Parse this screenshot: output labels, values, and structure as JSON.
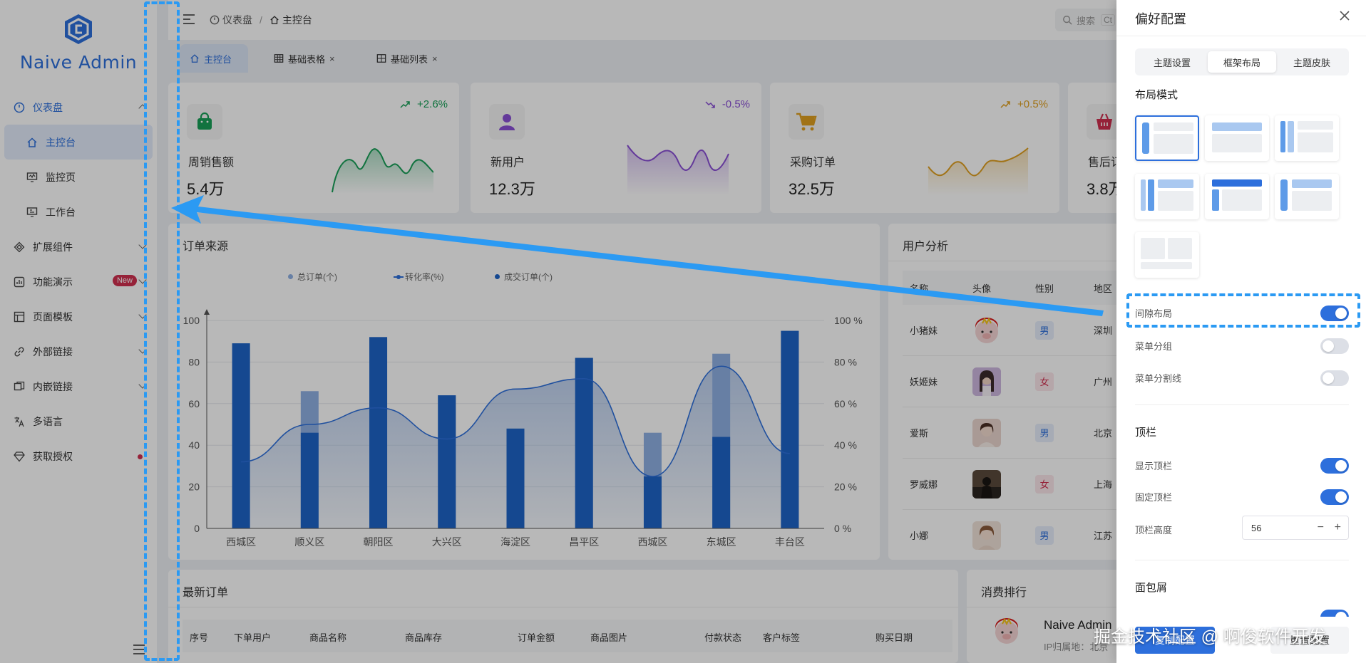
{
  "app": {
    "name": "Naive Admin"
  },
  "sidebar": {
    "items": [
      {
        "label": "仪表盘",
        "icon": "dashboard-icon"
      },
      {
        "label": "主控台",
        "icon": "home-icon"
      },
      {
        "label": "监控页",
        "icon": "monitor-icon"
      },
      {
        "label": "工作台",
        "icon": "workbench-icon"
      },
      {
        "label": "扩展组件",
        "icon": "puzzle-icon"
      },
      {
        "label": "功能演示",
        "icon": "feature-icon",
        "badge": "New"
      },
      {
        "label": "页面模板",
        "icon": "template-icon"
      },
      {
        "label": "外部链接",
        "icon": "link-icon"
      },
      {
        "label": "内嵌链接",
        "icon": "embed-icon"
      },
      {
        "label": "多语言",
        "icon": "translate-icon"
      },
      {
        "label": "获取授权",
        "icon": "diamond-icon"
      }
    ]
  },
  "header": {
    "breadcrumb": [
      "仪表盘",
      "主控台"
    ],
    "separator": "/",
    "search_placeholder": "搜索",
    "search_shortcut": "Ct"
  },
  "tabs": [
    {
      "label": "主控台",
      "icon": "home-icon",
      "closable": false
    },
    {
      "label": "基础表格",
      "icon": "table-icon",
      "closable": true
    },
    {
      "label": "基础列表",
      "icon": "table-icon",
      "closable": true
    }
  ],
  "tab_close_glyph": "×",
  "stats": [
    {
      "label": "周销售额",
      "value": "5.4万",
      "trend": "+2.6%",
      "color": "#18a058",
      "icon": "shopping-bag-icon"
    },
    {
      "label": "新用户",
      "value": "12.3万",
      "trend": "-0.5%",
      "color": "#8a4fd6",
      "icon": "user-icon"
    },
    {
      "label": "采购订单",
      "value": "32.5万",
      "trend": "+0.5%",
      "color": "#e0a020",
      "icon": "cart-icon"
    },
    {
      "label": "售后订",
      "value": "3.8万",
      "trend": "",
      "color": "#d03050",
      "icon": "basket-icon"
    }
  ],
  "order_source": {
    "title": "订单来源"
  },
  "chart_data": {
    "type": "bar",
    "title": "订单来源",
    "categories": [
      "西城区",
      "顺义区",
      "朝阳区",
      "大兴区",
      "海淀区",
      "昌平区",
      "西城区",
      "东城区",
      "丰台区"
    ],
    "series": [
      {
        "name": "总订单(个)",
        "kind": "bar",
        "values": [
          89,
          66,
          92,
          64,
          48,
          82,
          46,
          84,
          95
        ],
        "color": "#8fb0e4"
      },
      {
        "name": "转化率(%)",
        "kind": "line",
        "axis": "right",
        "values": [
          32,
          50,
          58,
          43,
          67,
          72,
          25,
          78,
          36
        ],
        "color": "#2d6fdc"
      },
      {
        "name": "成交订单(个)",
        "kind": "bar",
        "values": [
          89,
          46,
          92,
          64,
          48,
          82,
          25,
          44,
          95
        ],
        "color": "#1e64c8"
      }
    ],
    "ylim": [
      0,
      100
    ],
    "y_ticks": [
      "0",
      "20",
      "40",
      "60",
      "80",
      "100"
    ],
    "y2_ticks": [
      "0 %",
      "20 %",
      "40 %",
      "60 %",
      "80 %",
      "100 %"
    ],
    "grid": true,
    "legend_position": "top-center"
  },
  "user_analysis": {
    "title": "用户分析",
    "columns": [
      "名称",
      "头像",
      "性别",
      "地区"
    ],
    "rows": [
      {
        "name": "小猪妹",
        "gender": "男",
        "region": "深圳",
        "avatar": "pig-avatar"
      },
      {
        "name": "妖姬妹",
        "gender": "女",
        "region": "广州",
        "avatar": "girl-avatar"
      },
      {
        "name": "爱斯",
        "gender": "男",
        "region": "北京",
        "avatar": "woman-avatar"
      },
      {
        "name": "罗威娜",
        "gender": "女",
        "region": "上海",
        "avatar": "silhouette-avatar"
      },
      {
        "name": "小娜",
        "gender": "男",
        "region": "江苏",
        "avatar": "girl-avatar"
      }
    ]
  },
  "latest_orders": {
    "title": "最新订单",
    "columns": [
      "序号",
      "下单用户",
      "商品名称",
      "商品库存",
      "订单金额",
      "商品图片",
      "付款状态",
      "客户标签",
      "购买日期"
    ]
  },
  "ranking": {
    "title": "消费排行",
    "name": "Naive Admin",
    "sub": "IP归属地：北京"
  },
  "drawer": {
    "title": "偏好配置",
    "segments": [
      "主题设置",
      "框架布局",
      "主题皮肤"
    ],
    "active_segment": 1,
    "layout_mode_title": "布局模式",
    "toggles_1": [
      {
        "label": "间隙布局",
        "on": true
      },
      {
        "label": "菜单分组",
        "on": false
      },
      {
        "label": "菜单分割线",
        "on": false
      }
    ],
    "topbar_title": "顶栏",
    "toggles_2": [
      {
        "label": "显示顶栏",
        "on": true
      },
      {
        "label": "固定顶栏",
        "on": true
      }
    ],
    "topbar_height_label": "顶栏高度",
    "topbar_height": "56",
    "breadcrumb_title": "面包屑",
    "footer_primary": "复制配置",
    "footer_default": "重置配置"
  },
  "watermark": "掘金技术社区 @ 啊俊软件开发",
  "colors": {
    "primary": "#2d6fdc",
    "annotation": "#2b9af3",
    "danger": "#d03050"
  }
}
